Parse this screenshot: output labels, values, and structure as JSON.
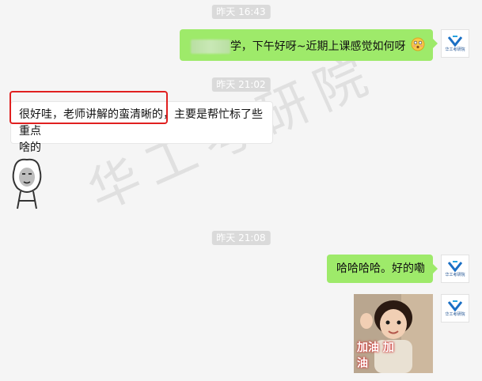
{
  "messages": {
    "ts1": "昨天 16:43",
    "msg1_text": "学，下午好呀~近期上课感觉如何呀",
    "ts2": "昨天 21:02",
    "msg2_line1": "很好哇，老师讲解的蛮清晰的，主要是帮忙标了些重点",
    "msg2_line2": "啥的",
    "ts3": "昨天 21:08",
    "msg3_text": "哈哈哈哈。好的嘞",
    "photo_caption": "加油 加油"
  },
  "watermark": "华工考研院",
  "avatar_label": "华工考研院",
  "colors": {
    "chat_bg": "#f5f5f5",
    "my_bubble": "#9eea6a",
    "their_bubble": "#ffffff",
    "highlight": "#e02020"
  }
}
